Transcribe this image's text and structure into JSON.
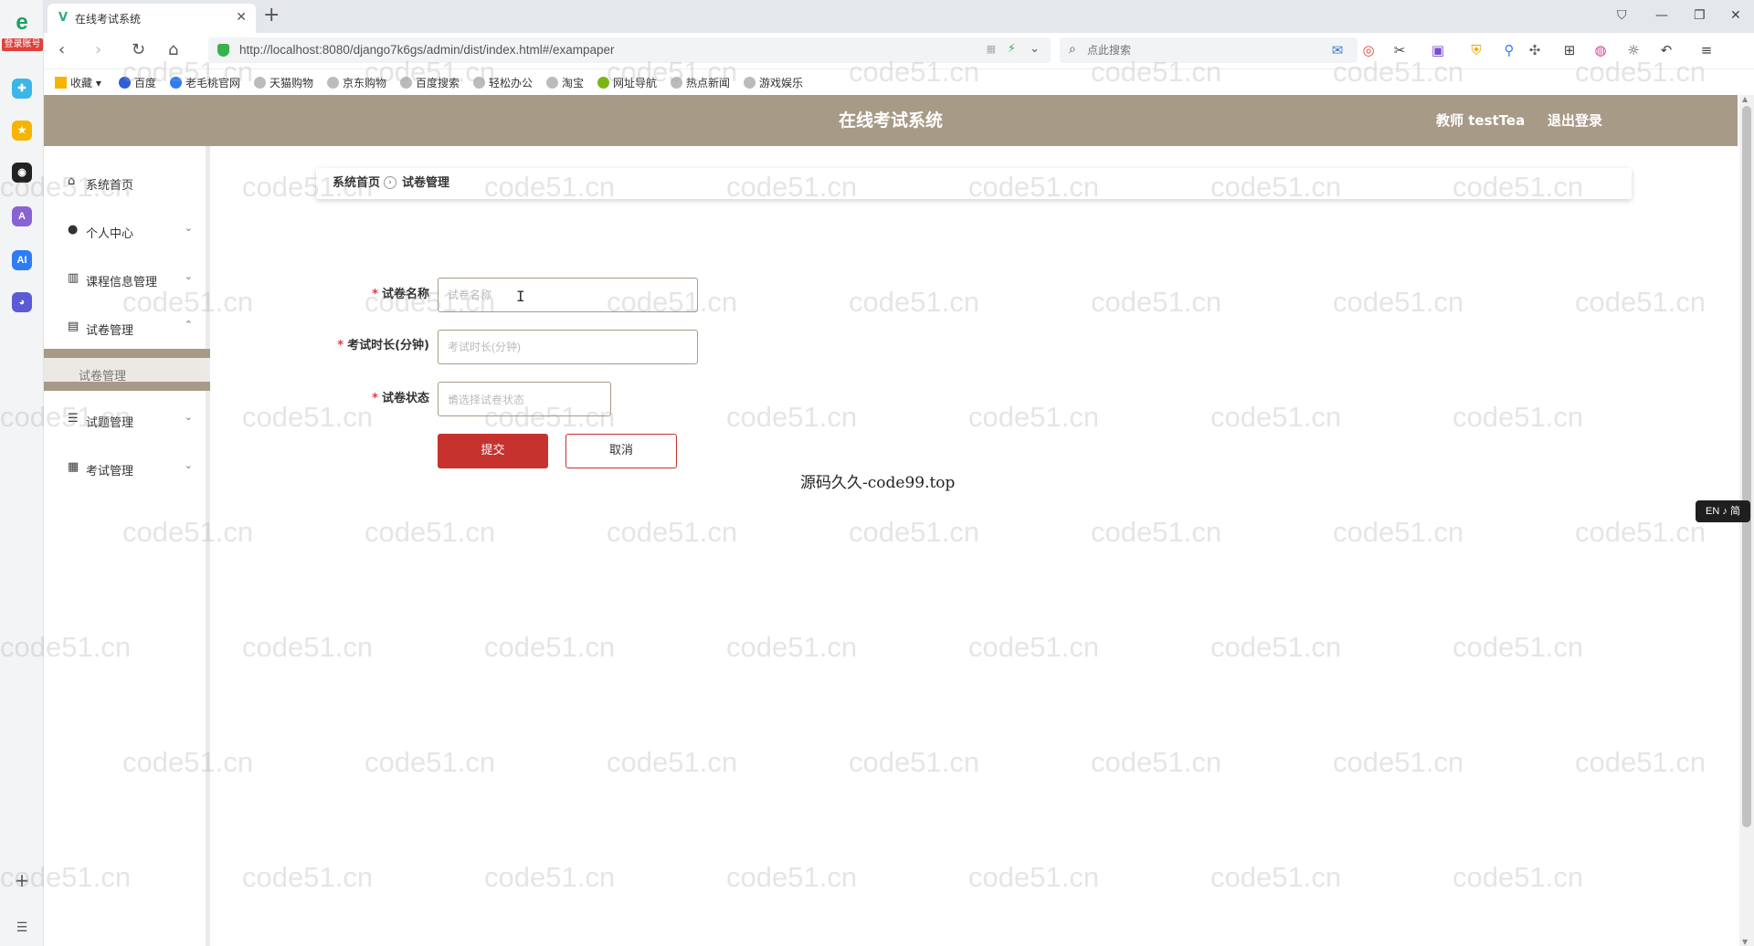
{
  "browser": {
    "tab_title": "在线考试系统",
    "new_tab": "+",
    "url": "http://localhost:8080/django7k6gs/admin/dist/index.html#/exampaper",
    "search_placeholder": "点此搜索",
    "rail_badge": "登录账号",
    "bookmarks": [
      "收藏",
      "百度",
      "老毛桃官网",
      "天猫购物",
      "京东购物",
      "百度搜索",
      "轻松办公",
      "淘宝",
      "网址导航",
      "热点新闻",
      "游戏娱乐"
    ]
  },
  "app": {
    "title": "在线考试系统",
    "user": "教师 testTea",
    "logout": "退出登录"
  },
  "sidebar": {
    "items": [
      {
        "label": "系统首页"
      },
      {
        "label": "个人中心"
      },
      {
        "label": "课程信息管理"
      },
      {
        "label": "试卷管理"
      },
      {
        "label": "试题管理"
      },
      {
        "label": "考试管理"
      }
    ],
    "sub_item": "试卷管理"
  },
  "breadcrumb": {
    "home": "系统首页",
    "current": "试卷管理"
  },
  "form": {
    "name_label": "试卷名称",
    "name_placeholder": "试卷名称",
    "duration_label": "考试时长(分钟)",
    "duration_placeholder": "考试时长(分钟)",
    "status_label": "试卷状态",
    "status_placeholder": "请选择试卷状态",
    "required_mark": "*",
    "submit": "提交",
    "cancel": "取消"
  },
  "footer_note": "源码久久-code99.top",
  "ime": "EN ♪ 简",
  "watermark": "code51.cn",
  "colors": {
    "header_bg": "#a79a87",
    "submit_bg": "#c6322e",
    "required": "#e03b3b"
  }
}
